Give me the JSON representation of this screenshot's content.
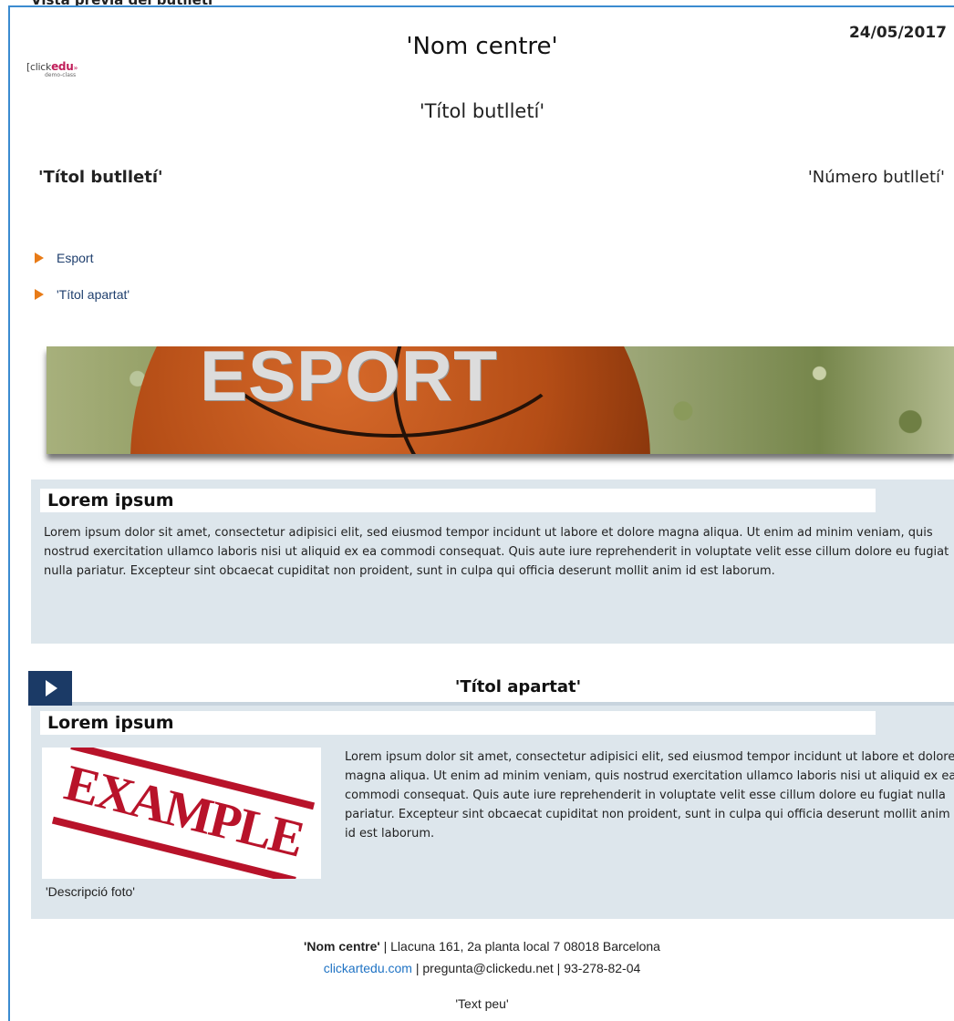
{
  "window": {
    "caption": "Vista prèvia del butlletí"
  },
  "header": {
    "date": "24/05/2017",
    "logo_text_prefix": "[click",
    "logo_text_brand": "edu",
    "logo_text_suffix": "»",
    "logo_subtext": "demo-class",
    "center_title": "'Nom centre'",
    "center_subtitle": "'Títol butlletí'"
  },
  "titles_row": {
    "left": "'Títol butlletí'",
    "right": "'Número butlletí'"
  },
  "toc": {
    "items": [
      "Esport",
      "'Títol apartat'"
    ]
  },
  "banner": {
    "word": "ESPORT"
  },
  "section1": {
    "heading": "Lorem ipsum",
    "body": "Lorem ipsum dolor sit amet, consectetur adipisici elit, sed eiusmod tempor incidunt ut labore et dolore magna aliqua. Ut enim ad minim veniam, quis nostrud exercitation ullamco laboris nisi ut aliquid ex ea commodi consequat. Quis aute iure reprehenderit in voluptate velit esse cillum dolore eu fugiat nulla pariatur. Excepteur sint obcaecat cupiditat non proident, sunt in culpa qui officia deserunt mollit anim id est laborum."
  },
  "apartat": {
    "title": "'Títol apartat'"
  },
  "section2": {
    "heading": "Lorem ipsum",
    "photo_text": "EXAMPLE",
    "photo_caption": "'Descripció foto'",
    "body": "Lorem ipsum dolor sit amet, consectetur adipisici elit, sed eiusmod tempor incidunt ut labore et dolore magna aliqua. Ut enim ad minim veniam, quis nostrud exercitation ullamco laboris nisi ut aliquid ex ea commodi consequat. Quis aute iure reprehenderit in voluptate velit esse cillum dolore eu fugiat nulla pariatur. Excepteur sint obcaecat cupiditat non proident, sunt in culpa qui officia deserunt mollit anim id est laborum."
  },
  "footer": {
    "center_name": "'Nom centre'",
    "address": " | Llacuna 161, 2a planta local 7 08018 Barcelona",
    "website": "clickartedu.com",
    "contact": " | pregunta@clickedu.net | 93-278-82-04",
    "text_peu": "'Text peu'"
  },
  "colors": {
    "frame": "#3b8bd0",
    "section_bg": "#dde6ec",
    "play_button": "#1b3a66",
    "toc_arrow": "#e87b17",
    "link": "#1f73c4"
  },
  "icons": [
    "play-icon",
    "toc-arrow-icon"
  ]
}
